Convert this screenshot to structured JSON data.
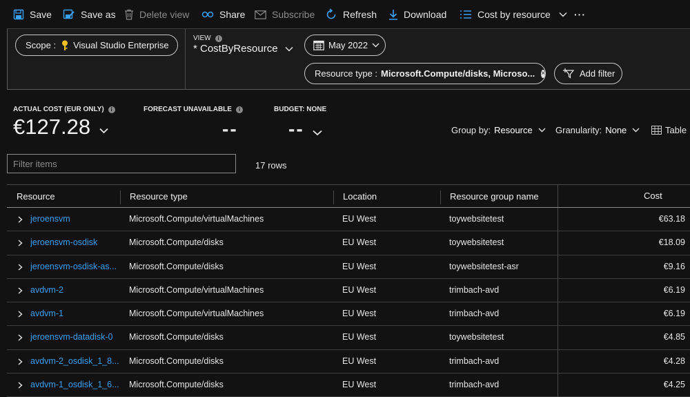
{
  "toolbar": {
    "save": "Save",
    "save_as": "Save as",
    "delete_view": "Delete view",
    "share": "Share",
    "subscribe": "Subscribe",
    "refresh": "Refresh",
    "download": "Download",
    "cost_by_resource": "Cost by resource",
    "more": "···"
  },
  "filters": {
    "scope_label": "Scope :",
    "scope_value": "Visual Studio Enterprise",
    "view_label": "VIEW",
    "view_name": "* CostByResource",
    "date": "May 2022",
    "resource_type_label": "Resource type :",
    "resource_type_value": "Microsoft.Compute/disks, Microso...",
    "add_filter": "Add filter"
  },
  "metrics": {
    "actual_label": "ACTUAL COST (EUR ONLY)",
    "actual_value": "€127.28",
    "forecast_label": "FORECAST UNAVAILABLE",
    "forecast_value": "--",
    "budget_label": "BUDGET: NONE",
    "budget_value": "--"
  },
  "controls": {
    "group_by_label": "Group by:",
    "group_by_value": "Resource",
    "granularity_label": "Granularity:",
    "granularity_value": "None",
    "table_label": "Table"
  },
  "search": {
    "placeholder": "Filter items",
    "rows": "17 rows"
  },
  "table": {
    "headers": [
      "Resource",
      "Resource type",
      "Location",
      "Resource group name",
      "Cost"
    ],
    "rows": [
      {
        "resource": "jeroensvm",
        "type": "Microsoft.Compute/virtualMachines",
        "location": "EU West",
        "group": "toywebsitetest",
        "cost": "€63.18"
      },
      {
        "resource": "jeroensvm-osdisk",
        "type": "Microsoft.Compute/disks",
        "location": "EU West",
        "group": "toywebsitetest",
        "cost": "€18.09"
      },
      {
        "resource": "jeroensvm-osdisk-as...",
        "type": "Microsoft.Compute/disks",
        "location": "EU West",
        "group": "toywebsitetest-asr",
        "cost": "€9.16"
      },
      {
        "resource": "avdvm-2",
        "type": "Microsoft.Compute/virtualMachines",
        "location": "EU West",
        "group": "trimbach-avd",
        "cost": "€6.19"
      },
      {
        "resource": "avdvm-1",
        "type": "Microsoft.Compute/virtualMachines",
        "location": "EU West",
        "group": "trimbach-avd",
        "cost": "€6.19"
      },
      {
        "resource": "jeroensvm-datadisk-0",
        "type": "Microsoft.Compute/disks",
        "location": "EU West",
        "group": "toywebsitetest",
        "cost": "€4.85"
      },
      {
        "resource": "avdvm-2_osdisk_1_8...",
        "type": "Microsoft.Compute/disks",
        "location": "EU West",
        "group": "trimbach-avd",
        "cost": "€4.28"
      },
      {
        "resource": "avdvm-1_osdisk_1_6...",
        "type": "Microsoft.Compute/disks",
        "location": "EU West",
        "group": "trimbach-avd",
        "cost": "€4.25"
      }
    ]
  },
  "colors": {
    "accent": "#3aa0f3",
    "background": "#121212",
    "panel": "#1b1b1b",
    "key_icon": "#f2c01e"
  }
}
